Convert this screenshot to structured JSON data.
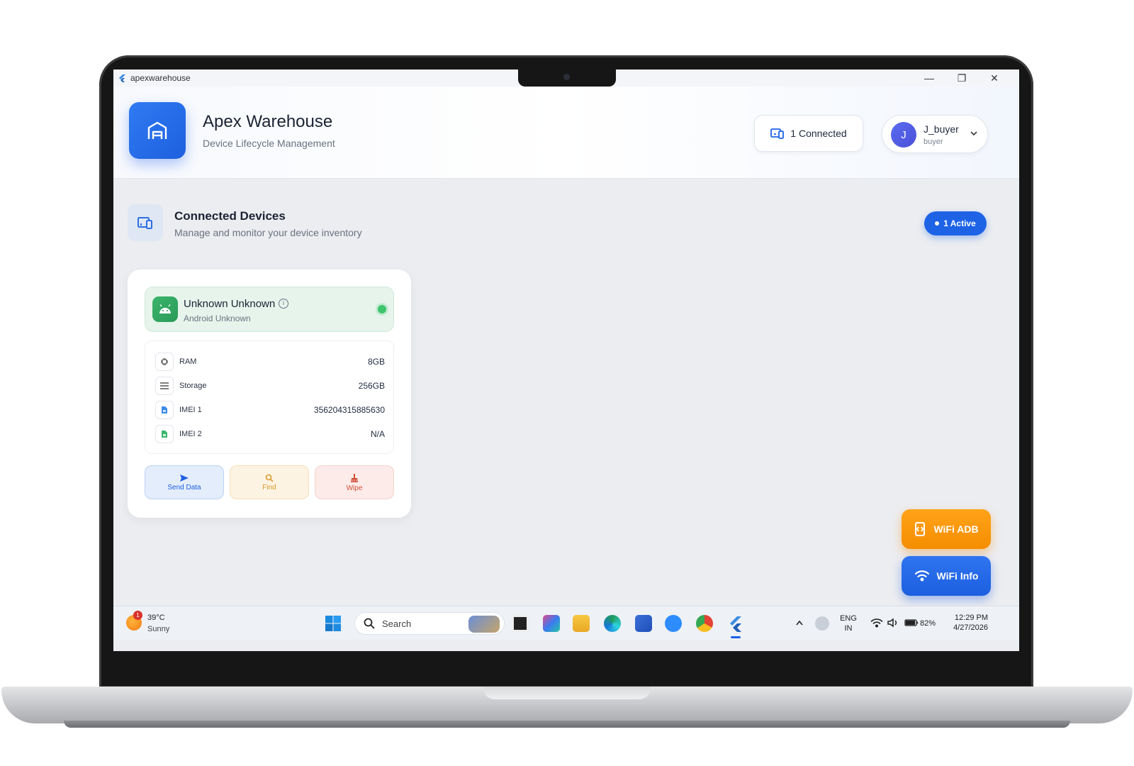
{
  "window": {
    "title": "apexwarehouse",
    "controls": {
      "minimize": "—",
      "maximize": "❐",
      "close": "✕"
    }
  },
  "header": {
    "app_title": "Apex Warehouse",
    "app_subtitle": "Device Lifecycle Management",
    "connected_label": "1 Connected",
    "user": {
      "initial": "J",
      "name": "J_buyer",
      "role": "buyer"
    }
  },
  "section": {
    "title": "Connected Devices",
    "subtitle": "Manage and monitor your device inventory",
    "active_label": "1 Active"
  },
  "device": {
    "name": "Unknown Unknown",
    "subtitle": "Android Unknown",
    "status": "online",
    "specs": [
      {
        "label": "RAM",
        "value": "8GB",
        "icon": "chip-icon"
      },
      {
        "label": "Storage",
        "value": "256GB",
        "icon": "storage-icon"
      },
      {
        "label": "IMEI 1",
        "value": "356204315885630",
        "icon": "sim-icon"
      },
      {
        "label": "IMEI 2",
        "value": "N/A",
        "icon": "sim-icon"
      }
    ],
    "actions": {
      "send": "Send Data",
      "find": "Find",
      "wipe": "Wipe"
    }
  },
  "floating": {
    "wifi_adb": "WiFi ADB",
    "wifi_info": "WiFi Info"
  },
  "taskbar": {
    "weather": {
      "temp": "39°C",
      "desc": "Sunny",
      "badge": "1"
    },
    "search_placeholder": "Search",
    "language": {
      "line1": "ENG",
      "line2": "IN"
    },
    "battery": "82%",
    "time": "12:29 PM",
    "date": "4/27/2026"
  },
  "colors": {
    "primary": "#1e63e6",
    "success": "#3ec46d",
    "warning": "#f58d00",
    "danger": "#d0503a"
  }
}
